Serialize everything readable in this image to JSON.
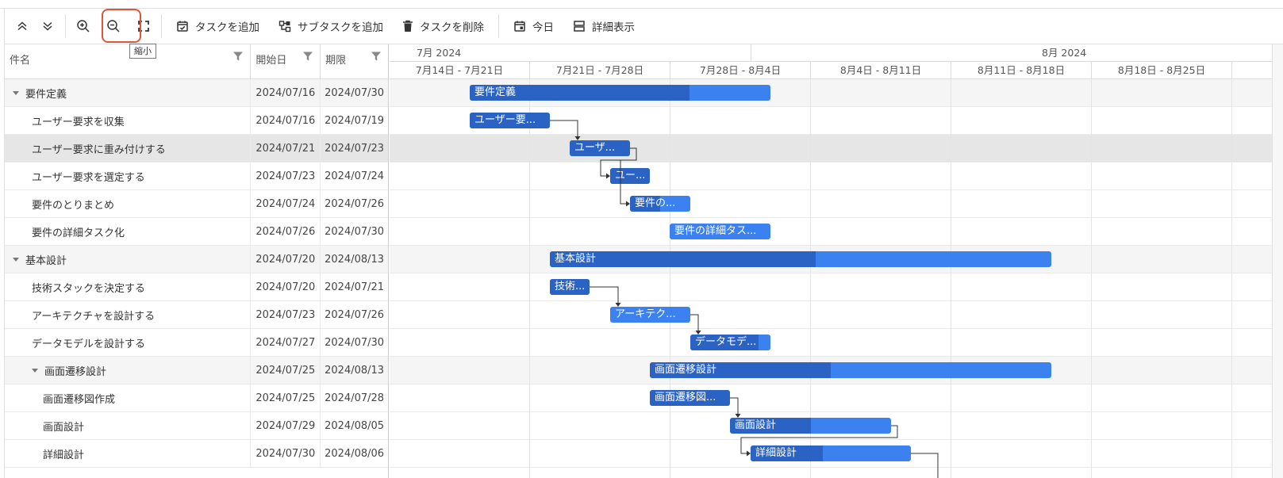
{
  "toolbar": {
    "collapse_all": "collapse-all",
    "expand_all": "expand-all",
    "zoom_in": "zoom-in",
    "zoom_out": "zoom-out",
    "fit": "fit-to-screen",
    "add_task_label": "タスクを追加",
    "add_subtask_label": "サブタスクを追加",
    "delete_task_label": "タスクを削除",
    "today_label": "今日",
    "details_label": "詳細表示",
    "tooltip": "縮小"
  },
  "grid": {
    "col_name": "件名",
    "col_start": "開始日",
    "col_end": "期限",
    "rows": [
      {
        "name": "要件定義",
        "start": "2024/07/16",
        "end": "2024/07/30",
        "level": 0,
        "summary": true
      },
      {
        "name": "ユーザー要求を収集",
        "start": "2024/07/16",
        "end": "2024/07/19",
        "level": 1
      },
      {
        "name": "ユーザー要求に重み付けする",
        "start": "2024/07/21",
        "end": "2024/07/23",
        "level": 1,
        "selected": true
      },
      {
        "name": "ユーザー要求を選定する",
        "start": "2024/07/23",
        "end": "2024/07/24",
        "level": 1
      },
      {
        "name": "要件のとりまとめ",
        "start": "2024/07/24",
        "end": "2024/07/26",
        "level": 1
      },
      {
        "name": "要件の詳細タスク化",
        "start": "2024/07/26",
        "end": "2024/07/30",
        "level": 1
      },
      {
        "name": "基本設計",
        "start": "2024/07/20",
        "end": "2024/08/13",
        "level": 0,
        "summary": true
      },
      {
        "name": "技術スタックを決定する",
        "start": "2024/07/20",
        "end": "2024/07/21",
        "level": 1
      },
      {
        "name": "アーキテクチャを設計する",
        "start": "2024/07/23",
        "end": "2024/07/26",
        "level": 1
      },
      {
        "name": "データモデルを設計する",
        "start": "2024/07/27",
        "end": "2024/07/30",
        "level": 1
      },
      {
        "name": "画面遷移設計",
        "start": "2024/07/25",
        "end": "2024/08/13",
        "level": 1,
        "summary": true
      },
      {
        "name": "画面遷移図作成",
        "start": "2024/07/25",
        "end": "2024/07/28",
        "level": 2
      },
      {
        "name": "画面設計",
        "start": "2024/07/29",
        "end": "2024/08/05",
        "level": 2
      },
      {
        "name": "詳細設計",
        "start": "2024/07/30",
        "end": "2024/08/06",
        "level": 2
      }
    ]
  },
  "timeline": {
    "months": [
      "7月 2024",
      "8月 2024"
    ],
    "weeks": [
      "7月14日 - 7月21日",
      "7月21日 - 7月28日",
      "7月28日 - 8月4日",
      "8月4日 - 8月11日",
      "8月11日 - 8月18日",
      "8月18日 - 8月25日"
    ],
    "bars": [
      {
        "label": "要件定義",
        "progress": 0.73
      },
      {
        "label": "ユーザー要...",
        "progress": 1
      },
      {
        "label": "ユーザ...",
        "progress": 1
      },
      {
        "label": "ユー...",
        "progress": 1
      },
      {
        "label": "要件の...",
        "progress": 0.5
      },
      {
        "label": "要件の詳細タス...",
        "progress": 0
      },
      {
        "label": "基本設計",
        "progress": 0.53
      },
      {
        "label": "技術...",
        "progress": 1
      },
      {
        "label": "アーキテク...",
        "progress": 0
      },
      {
        "label": "データモデ...",
        "progress": 0.85
      },
      {
        "label": "画面遷移設計",
        "progress": 0.45
      },
      {
        "label": "画面遷移図...",
        "progress": 1
      },
      {
        "label": "画面設計",
        "progress": 0.5
      },
      {
        "label": "詳細設計",
        "progress": 0.45
      }
    ]
  },
  "colors": {
    "bar": "#3b82f0",
    "progress": "#2b63c4",
    "highlight": "#e0553a"
  }
}
